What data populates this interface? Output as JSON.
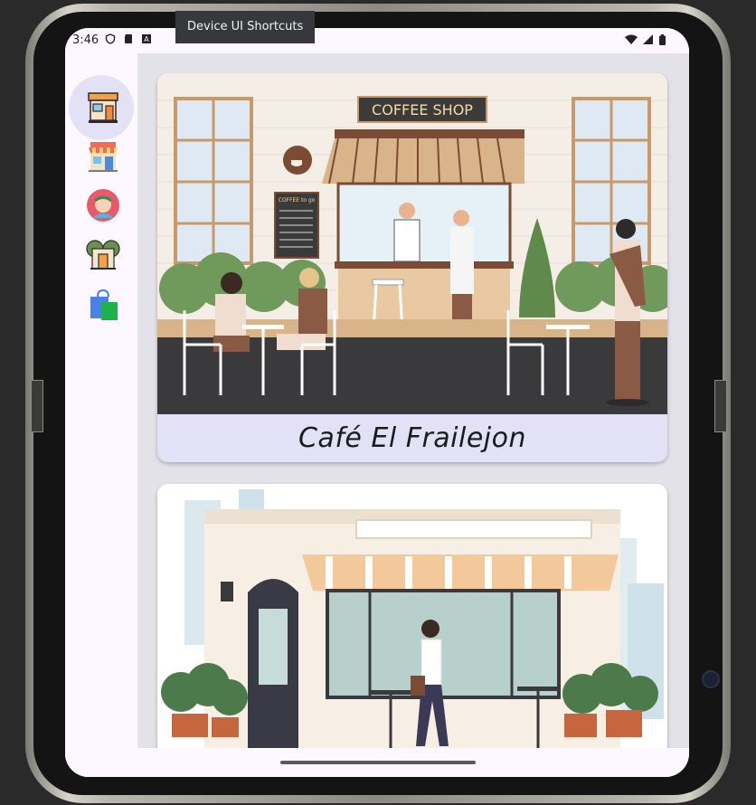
{
  "tooltip": {
    "text": "Device UI Shortcuts"
  },
  "status_bar": {
    "time": "3:46",
    "left_icons": [
      "shield-icon",
      "sd-card-icon",
      "keyboard-a-icon"
    ],
    "right_icons": [
      "wifi-icon",
      "signal-icon",
      "battery-icon"
    ]
  },
  "nav_rail": {
    "items": [
      {
        "icon": "coffee-shop-icon",
        "selected": true
      },
      {
        "icon": "store-icon",
        "selected": false
      },
      {
        "icon": "avatar-icon",
        "selected": false
      },
      {
        "icon": "bakery-icon",
        "selected": false
      },
      {
        "icon": "shopping-bag-icon",
        "selected": false
      }
    ]
  },
  "cards": [
    {
      "title": "Café El Frailejon",
      "sign_text": "COFFEE SHOP",
      "menu_text": "COFFEE to go"
    },
    {
      "title": ""
    }
  ],
  "colors": {
    "accent": "#e2e1f6",
    "surface": "#fdf8ff",
    "content_background": "#e3e2e9"
  }
}
